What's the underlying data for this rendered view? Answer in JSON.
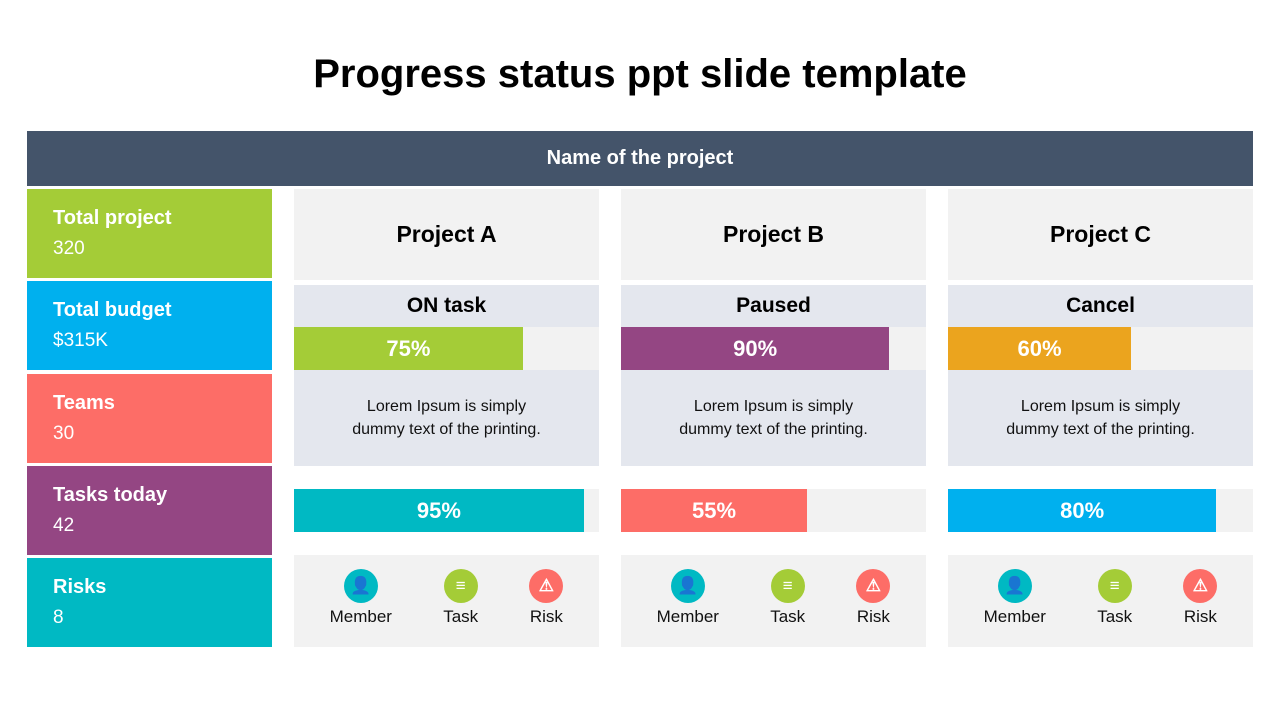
{
  "title": "Progress status ppt slide template",
  "header": "Name of the project",
  "stats": [
    {
      "label": "Total project",
      "value": "320",
      "color": "#a4cc37"
    },
    {
      "label": "Total budget",
      "value": "$315K",
      "color": "#00b0ee"
    },
    {
      "label": "Teams",
      "value": "30",
      "color": "#fd6d67"
    },
    {
      "label": "Tasks today",
      "value": "42",
      "color": "#944683"
    },
    {
      "label": "Risks",
      "value": "8",
      "color": "#00b9c3"
    }
  ],
  "projects": [
    {
      "name": "Project A",
      "status": "ON task",
      "progress": {
        "value": 75,
        "label": "75%",
        "color": "#a4cc37"
      },
      "desc1": "Lorem Ipsum is simply",
      "desc2": "dummy text of the printing.",
      "progress2": {
        "value": 95,
        "label": "95%",
        "color": "#00b9c3"
      }
    },
    {
      "name": "Project B",
      "status": "Paused",
      "progress": {
        "value": 88,
        "label": "90%",
        "color": "#944683"
      },
      "desc1": "Lorem Ipsum is simply",
      "desc2": "dummy text of the printing.",
      "progress2": {
        "value": 61,
        "label": "55%",
        "color": "#fd6d67"
      }
    },
    {
      "name": "Project  C",
      "status": "Cancel",
      "progress": {
        "value": 60,
        "label": "60%",
        "color": "#eba41e"
      },
      "desc1": "Lorem Ipsum is simply",
      "desc2": "dummy text of the printing.",
      "progress2": {
        "value": 88,
        "label": "80%",
        "color": "#00b0ee"
      }
    }
  ],
  "icons": [
    {
      "label": "Member",
      "glyph": "👤",
      "color": "#00b9c3"
    },
    {
      "label": "Task",
      "glyph": "≡",
      "color": "#a4cc37"
    },
    {
      "label": "Risk",
      "glyph": "⚠",
      "color": "#fd6d67"
    }
  ]
}
